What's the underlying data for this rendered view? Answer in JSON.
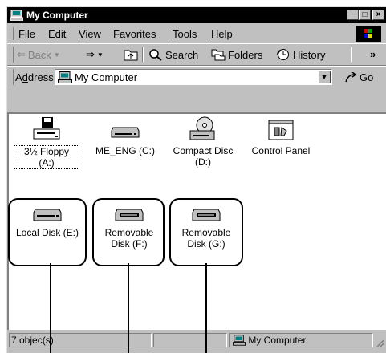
{
  "window": {
    "title": "My Computer"
  },
  "title_buttons": {
    "minimize": "_",
    "maximize": "□",
    "close": "×"
  },
  "menu": [
    {
      "label": "File",
      "accel_index": 0
    },
    {
      "label": "Edit",
      "accel_index": 0
    },
    {
      "label": "View",
      "accel_index": 0
    },
    {
      "label": "Favorites",
      "accel_index": 1
    },
    {
      "label": "Tools",
      "accel_index": 0
    },
    {
      "label": "Help",
      "accel_index": 0
    }
  ],
  "toolbar": {
    "back": "Back",
    "search": "Search",
    "folders": "Folders",
    "history": "History",
    "more": "»"
  },
  "address": {
    "label": "Address",
    "value": "My Computer",
    "go": "Go"
  },
  "items": [
    {
      "label": "3½ Floppy (A:)",
      "icon": "floppy-drive-icon"
    },
    {
      "label": "ME_ENG (C:)",
      "icon": "hard-disk-icon"
    },
    {
      "label": "Compact Disc (D:)",
      "icon": "cd-drive-icon"
    },
    {
      "label": "Control Panel",
      "icon": "control-panel-icon"
    },
    {
      "label": "Local Disk (E:)",
      "icon": "hard-disk-icon"
    },
    {
      "label": "Removable Disk (F:)",
      "icon": "removable-disk-icon"
    },
    {
      "label": "Removable Disk (G:)",
      "icon": "removable-disk-icon"
    }
  ],
  "status": {
    "count": "7 objec(s)",
    "zone": "My Computer"
  }
}
